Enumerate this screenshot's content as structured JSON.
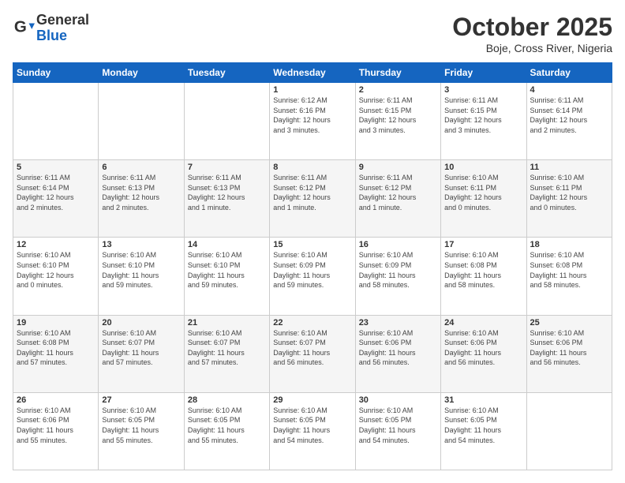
{
  "logo": {
    "line1": "General",
    "line2": "Blue"
  },
  "title": "October 2025",
  "subtitle": "Boje, Cross River, Nigeria",
  "weekdays": [
    "Sunday",
    "Monday",
    "Tuesday",
    "Wednesday",
    "Thursday",
    "Friday",
    "Saturday"
  ],
  "weeks": [
    [
      {
        "day": "",
        "info": ""
      },
      {
        "day": "",
        "info": ""
      },
      {
        "day": "",
        "info": ""
      },
      {
        "day": "1",
        "info": "Sunrise: 6:12 AM\nSunset: 6:16 PM\nDaylight: 12 hours\nand 3 minutes."
      },
      {
        "day": "2",
        "info": "Sunrise: 6:11 AM\nSunset: 6:15 PM\nDaylight: 12 hours\nand 3 minutes."
      },
      {
        "day": "3",
        "info": "Sunrise: 6:11 AM\nSunset: 6:15 PM\nDaylight: 12 hours\nand 3 minutes."
      },
      {
        "day": "4",
        "info": "Sunrise: 6:11 AM\nSunset: 6:14 PM\nDaylight: 12 hours\nand 2 minutes."
      }
    ],
    [
      {
        "day": "5",
        "info": "Sunrise: 6:11 AM\nSunset: 6:14 PM\nDaylight: 12 hours\nand 2 minutes."
      },
      {
        "day": "6",
        "info": "Sunrise: 6:11 AM\nSunset: 6:13 PM\nDaylight: 12 hours\nand 2 minutes."
      },
      {
        "day": "7",
        "info": "Sunrise: 6:11 AM\nSunset: 6:13 PM\nDaylight: 12 hours\nand 1 minute."
      },
      {
        "day": "8",
        "info": "Sunrise: 6:11 AM\nSunset: 6:12 PM\nDaylight: 12 hours\nand 1 minute."
      },
      {
        "day": "9",
        "info": "Sunrise: 6:11 AM\nSunset: 6:12 PM\nDaylight: 12 hours\nand 1 minute."
      },
      {
        "day": "10",
        "info": "Sunrise: 6:10 AM\nSunset: 6:11 PM\nDaylight: 12 hours\nand 0 minutes."
      },
      {
        "day": "11",
        "info": "Sunrise: 6:10 AM\nSunset: 6:11 PM\nDaylight: 12 hours\nand 0 minutes."
      }
    ],
    [
      {
        "day": "12",
        "info": "Sunrise: 6:10 AM\nSunset: 6:10 PM\nDaylight: 12 hours\nand 0 minutes."
      },
      {
        "day": "13",
        "info": "Sunrise: 6:10 AM\nSunset: 6:10 PM\nDaylight: 11 hours\nand 59 minutes."
      },
      {
        "day": "14",
        "info": "Sunrise: 6:10 AM\nSunset: 6:10 PM\nDaylight: 11 hours\nand 59 minutes."
      },
      {
        "day": "15",
        "info": "Sunrise: 6:10 AM\nSunset: 6:09 PM\nDaylight: 11 hours\nand 59 minutes."
      },
      {
        "day": "16",
        "info": "Sunrise: 6:10 AM\nSunset: 6:09 PM\nDaylight: 11 hours\nand 58 minutes."
      },
      {
        "day": "17",
        "info": "Sunrise: 6:10 AM\nSunset: 6:08 PM\nDaylight: 11 hours\nand 58 minutes."
      },
      {
        "day": "18",
        "info": "Sunrise: 6:10 AM\nSunset: 6:08 PM\nDaylight: 11 hours\nand 58 minutes."
      }
    ],
    [
      {
        "day": "19",
        "info": "Sunrise: 6:10 AM\nSunset: 6:08 PM\nDaylight: 11 hours\nand 57 minutes."
      },
      {
        "day": "20",
        "info": "Sunrise: 6:10 AM\nSunset: 6:07 PM\nDaylight: 11 hours\nand 57 minutes."
      },
      {
        "day": "21",
        "info": "Sunrise: 6:10 AM\nSunset: 6:07 PM\nDaylight: 11 hours\nand 57 minutes."
      },
      {
        "day": "22",
        "info": "Sunrise: 6:10 AM\nSunset: 6:07 PM\nDaylight: 11 hours\nand 56 minutes."
      },
      {
        "day": "23",
        "info": "Sunrise: 6:10 AM\nSunset: 6:06 PM\nDaylight: 11 hours\nand 56 minutes."
      },
      {
        "day": "24",
        "info": "Sunrise: 6:10 AM\nSunset: 6:06 PM\nDaylight: 11 hours\nand 56 minutes."
      },
      {
        "day": "25",
        "info": "Sunrise: 6:10 AM\nSunset: 6:06 PM\nDaylight: 11 hours\nand 56 minutes."
      }
    ],
    [
      {
        "day": "26",
        "info": "Sunrise: 6:10 AM\nSunset: 6:06 PM\nDaylight: 11 hours\nand 55 minutes."
      },
      {
        "day": "27",
        "info": "Sunrise: 6:10 AM\nSunset: 6:05 PM\nDaylight: 11 hours\nand 55 minutes."
      },
      {
        "day": "28",
        "info": "Sunrise: 6:10 AM\nSunset: 6:05 PM\nDaylight: 11 hours\nand 55 minutes."
      },
      {
        "day": "29",
        "info": "Sunrise: 6:10 AM\nSunset: 6:05 PM\nDaylight: 11 hours\nand 54 minutes."
      },
      {
        "day": "30",
        "info": "Sunrise: 6:10 AM\nSunset: 6:05 PM\nDaylight: 11 hours\nand 54 minutes."
      },
      {
        "day": "31",
        "info": "Sunrise: 6:10 AM\nSunset: 6:05 PM\nDaylight: 11 hours\nand 54 minutes."
      },
      {
        "day": "",
        "info": ""
      }
    ]
  ]
}
